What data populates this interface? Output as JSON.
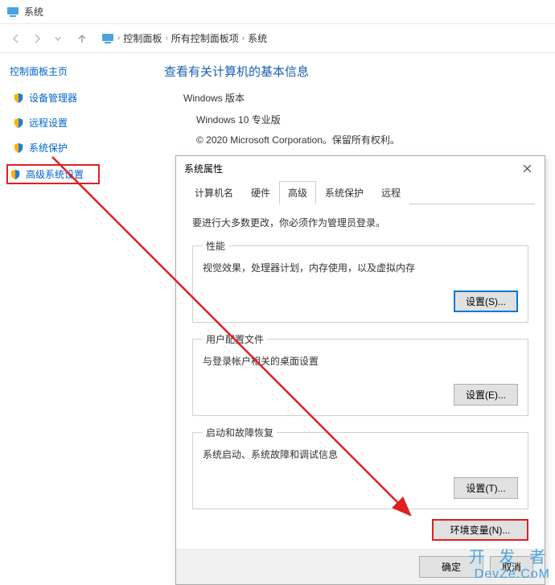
{
  "titlebar": {
    "title": "系统"
  },
  "breadcrumb": {
    "seg1": "控制面板",
    "seg2": "所有控制面板项",
    "seg3": "系统"
  },
  "sidebar": {
    "home": "控制面板主页",
    "items": [
      {
        "label": "设备管理器"
      },
      {
        "label": "远程设置"
      },
      {
        "label": "系统保护"
      },
      {
        "label": "高级系统设置"
      }
    ]
  },
  "content": {
    "heading": "查看有关计算机的基本信息",
    "windows_version_label": "Windows 版本",
    "edition": "Windows 10 专业版",
    "copyright": "© 2020 Microsoft Corporation。保留所有权利。"
  },
  "dialog": {
    "title": "系统属性",
    "tabs": [
      {
        "label": "计算机名"
      },
      {
        "label": "硬件"
      },
      {
        "label": "高级"
      },
      {
        "label": "系统保护"
      },
      {
        "label": "远程"
      }
    ],
    "admin_note": "要进行大多数更改，你必须作为管理员登录。",
    "perf": {
      "legend": "性能",
      "desc": "视觉效果，处理器计划，内存使用，以及虚拟内存",
      "btn": "设置(S)..."
    },
    "profile": {
      "legend": "用户配置文件",
      "desc": "与登录帐户相关的桌面设置",
      "btn": "设置(E)..."
    },
    "startup": {
      "legend": "启动和故障恢复",
      "desc": "系统启动、系统故障和调试信息",
      "btn": "设置(T)..."
    },
    "env_btn": "环境变量(N)...",
    "ok": "确定",
    "cancel": "取消"
  },
  "watermark": {
    "cn": "开 发 者",
    "en": "DevZe.CoM"
  }
}
